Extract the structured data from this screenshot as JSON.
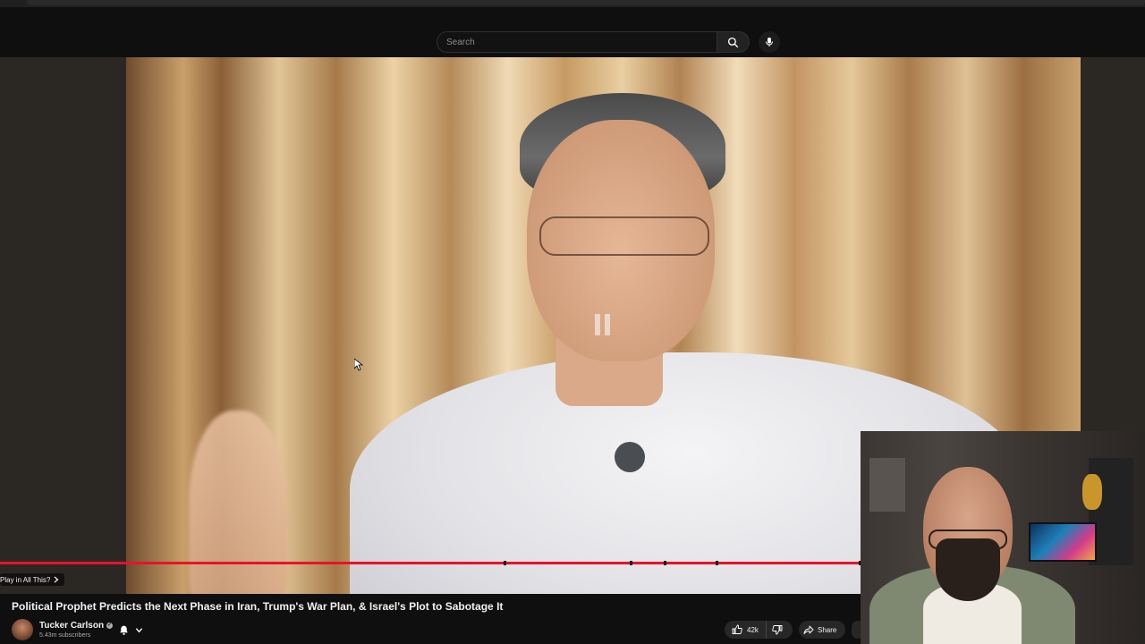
{
  "header": {
    "search_placeholder": "Search"
  },
  "player": {
    "progress_fraction": 0.752,
    "chapter_label": "Play in All This?",
    "chapter_marks_fraction": [
      0.44,
      0.55,
      0.58,
      0.625,
      0.75
    ]
  },
  "video": {
    "title": "Political Prophet Predicts the Next Phase in Iran, Trump's War Plan, & Israel's Plot to Sabotage It",
    "channel": "Tucker Carlson",
    "subscribers": "5.43m subscribers",
    "likes": "42k",
    "share_label": "Share"
  },
  "colors": {
    "progress": "#e8122a",
    "background": "#0f0f0f"
  }
}
